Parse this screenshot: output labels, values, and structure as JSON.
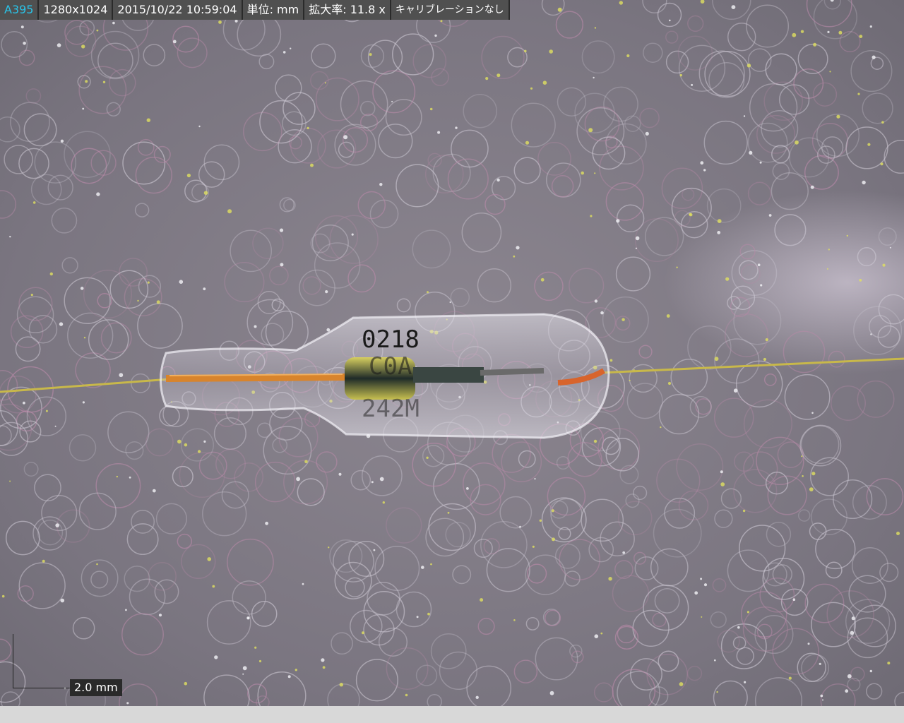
{
  "status_bar": {
    "image_id": "A395",
    "resolution": "1280x1024",
    "timestamp": "2015/10/22 10:59:04",
    "unit": "単位: mm",
    "magnification": "拡大率:  11.8 x",
    "calibration": "キャリブレーションなし"
  },
  "scale_bar": {
    "label": "2.0 mm"
  },
  "specimen": {
    "marking_top": "0218",
    "marking_mid": "C0A",
    "marking_bottom": "242M"
  },
  "colors": {
    "id_accent": "#29c4e8",
    "lead_wire": "#c8b84a",
    "copper_wire": "#d8842c"
  }
}
